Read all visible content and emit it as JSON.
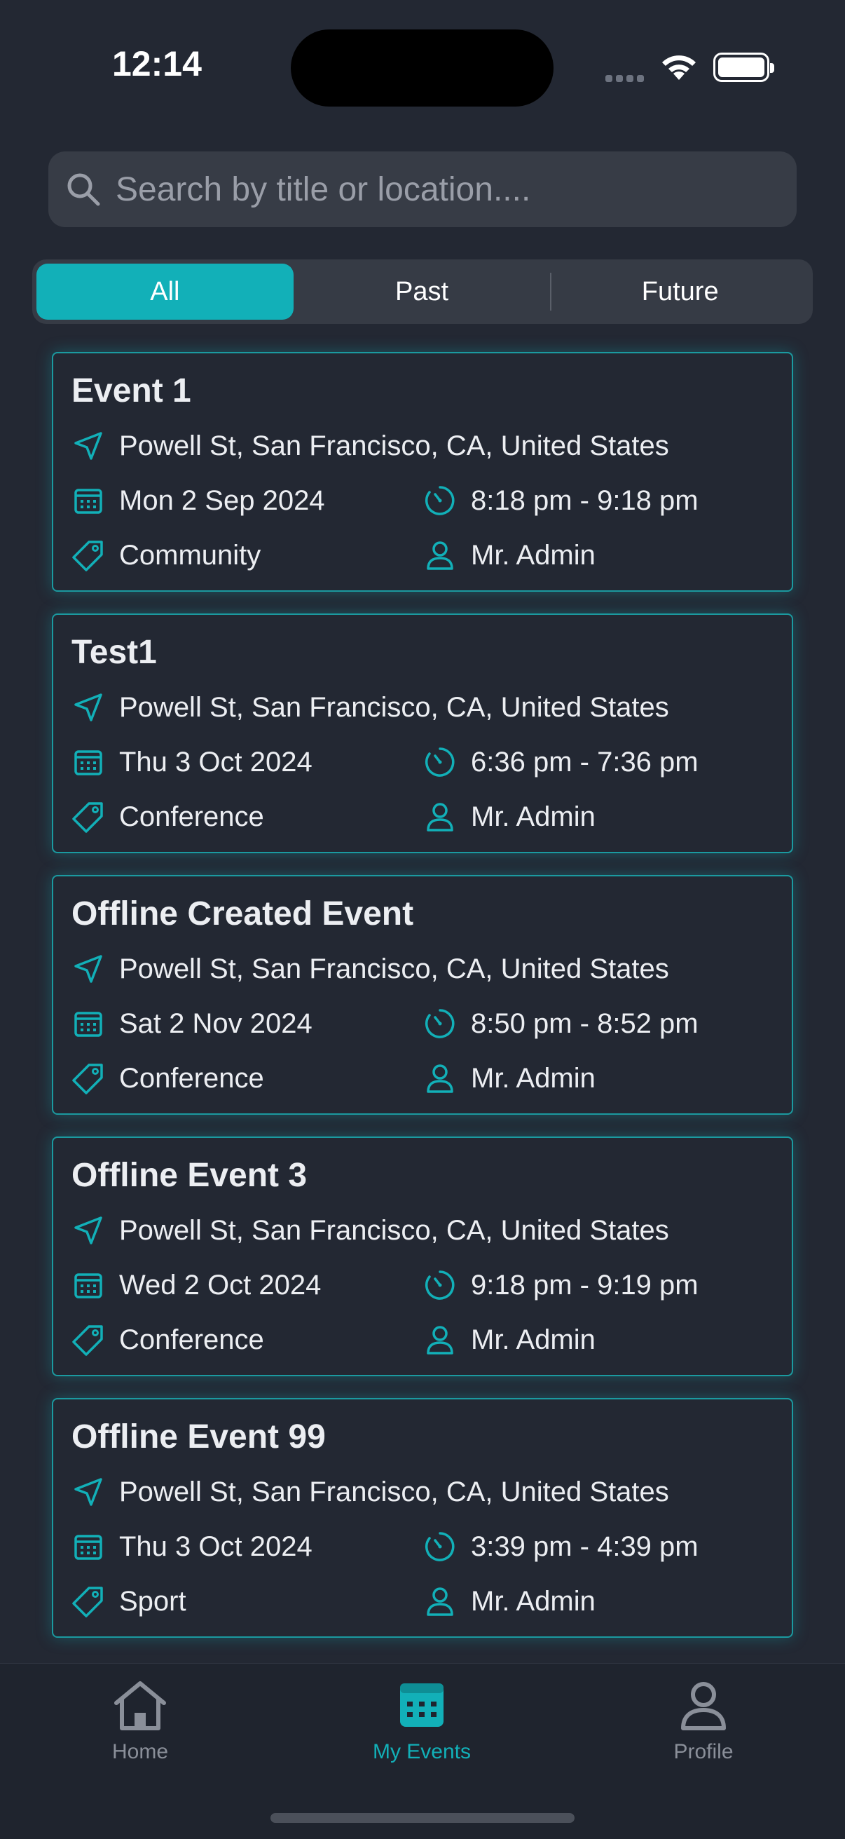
{
  "status_bar": {
    "time": "12:14"
  },
  "search": {
    "placeholder": "Search by title or location...."
  },
  "filters": {
    "items": [
      "All",
      "Past",
      "Future"
    ],
    "selected": "All"
  },
  "accent_color": "#12b0b8",
  "events": [
    {
      "title": "Event 1",
      "location": "Powell St, San Francisco, CA, United States",
      "date": "Mon 2 Sep 2024",
      "time": "8:18 pm - 9:18 pm",
      "category": "Community",
      "organizer": "Mr. Admin"
    },
    {
      "title": "Test1",
      "location": "Powell St, San Francisco, CA, United States",
      "date": "Thu 3 Oct 2024",
      "time": "6:36 pm - 7:36 pm",
      "category": "Conference",
      "organizer": "Mr. Admin"
    },
    {
      "title": "Offline Created Event",
      "location": "Powell St, San Francisco, CA, United States",
      "date": "Sat 2 Nov 2024",
      "time": "8:50 pm - 8:52 pm",
      "category": "Conference",
      "organizer": "Mr. Admin"
    },
    {
      "title": "Offline Event 3",
      "location": "Powell St, San Francisco, CA, United States",
      "date": "Wed 2 Oct 2024",
      "time": "9:18 pm - 9:19 pm",
      "category": "Conference",
      "organizer": "Mr. Admin"
    },
    {
      "title": "Offline Event 99",
      "location": "Powell St, San Francisco, CA, United States",
      "date": "Thu 3 Oct 2024",
      "time": "3:39 pm - 4:39 pm",
      "category": "Sport",
      "organizer": "Mr. Admin"
    }
  ],
  "tabbar": {
    "items": [
      {
        "label": "Home",
        "icon": "home-icon"
      },
      {
        "label": "My Events",
        "icon": "calendar-icon"
      },
      {
        "label": "Profile",
        "icon": "person-icon"
      }
    ],
    "selected": "My Events"
  }
}
